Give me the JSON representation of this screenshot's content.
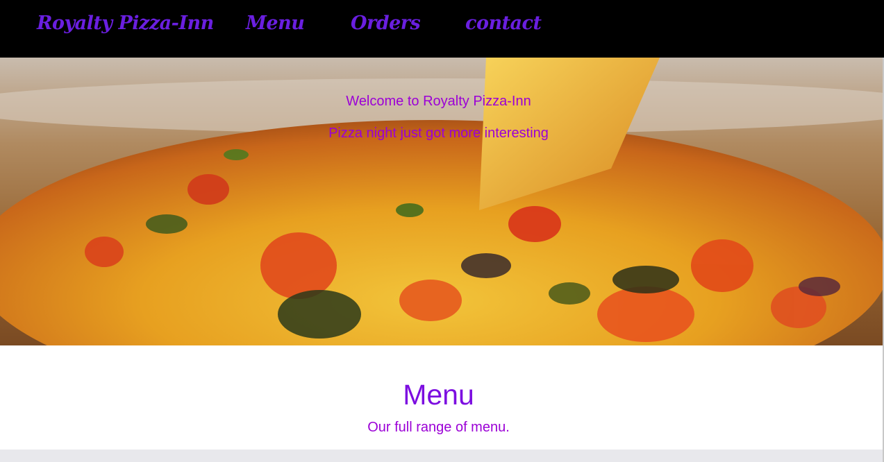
{
  "nav": {
    "brand": "Royalty Pizza-Inn",
    "items": [
      {
        "label": "Menu"
      },
      {
        "label": "Orders"
      },
      {
        "label": "contact"
      }
    ]
  },
  "hero": {
    "welcome": "Welcome to Royalty Pizza-Inn",
    "tagline": "Pizza night just got more interesting"
  },
  "menu_section": {
    "title": "Menu",
    "subtitle": "Our full range of menu."
  },
  "colors": {
    "nav_background": "#000000",
    "nav_link": "#6a1fe0",
    "hero_text": "#9b00d6",
    "menu_title": "#7c0de0"
  }
}
